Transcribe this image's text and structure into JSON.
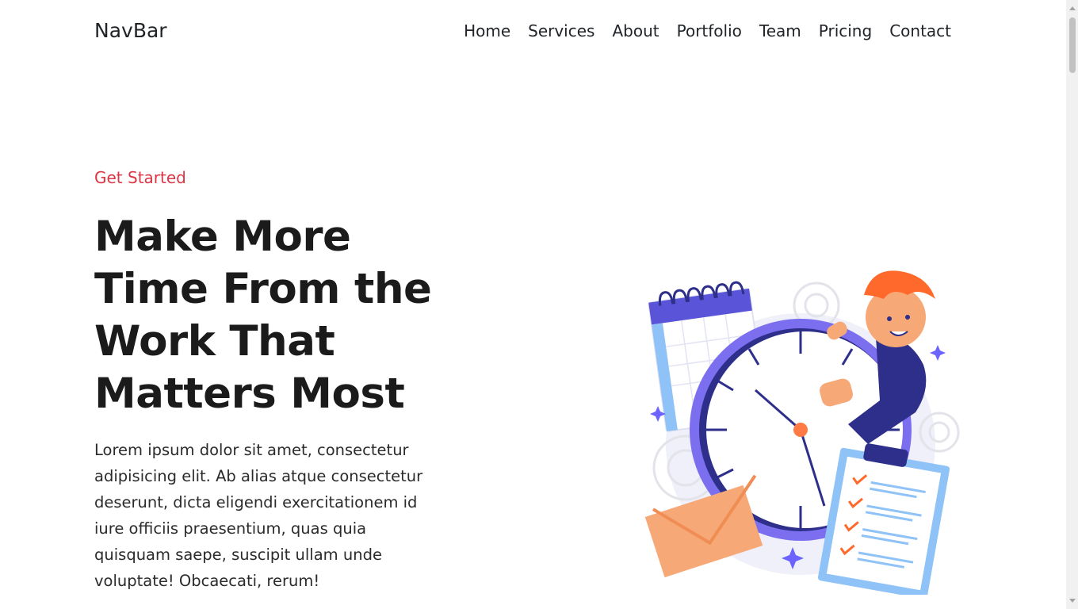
{
  "navbar": {
    "brand": "NavBar",
    "links": [
      "Home",
      "Services",
      "About",
      "Portfolio",
      "Team",
      "Pricing",
      "Contact"
    ]
  },
  "hero": {
    "eyebrow": "Get Started",
    "title": "Make More Time From the Work That Matters Most",
    "description": "Lorem ipsum dolor sit amet, consectetur adipisicing elit. Ab alias atque consectetur deserunt, dicta eligendi exercitationem id iure officiis praesentium, quas quia quisquam saepe, suscipit ullam unde voluptate! Obcaecati, rerum!"
  },
  "illustration": {
    "subject": "person-with-clock-calendar-clipboard-illustration"
  },
  "colors": {
    "accent_red": "#dc3545",
    "text_dark": "#1b1b1b",
    "illustration_purple": "#6c63ff",
    "illustration_navy": "#2e2f8a",
    "illustration_orange": "#ff7a45",
    "illustration_peach": "#f7a877",
    "illustration_blue": "#8fc2f7"
  }
}
